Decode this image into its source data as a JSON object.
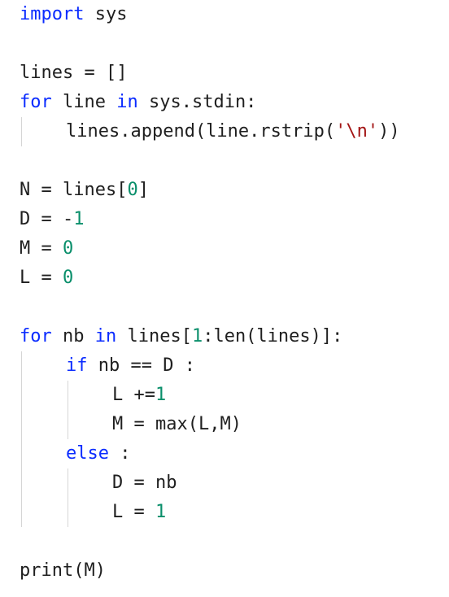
{
  "editor": {
    "language": "python",
    "colors": {
      "background": "#ffffff",
      "text": "#1f1f1f",
      "keyword": "#0b2cff",
      "number": "#0a8f6b",
      "string": "#a31515",
      "indent_guide": "#d6d6d6"
    },
    "lines": [
      {
        "indent": 0,
        "tokens": [
          {
            "t": "import",
            "k": "keyword"
          },
          {
            "t": " sys",
            "k": "plain"
          }
        ]
      },
      {
        "indent": 0,
        "tokens": []
      },
      {
        "indent": 0,
        "tokens": [
          {
            "t": "lines = []",
            "k": "plain"
          }
        ]
      },
      {
        "indent": 0,
        "tokens": [
          {
            "t": "for",
            "k": "keyword"
          },
          {
            "t": " line ",
            "k": "plain"
          },
          {
            "t": "in",
            "k": "keyword"
          },
          {
            "t": " sys.stdin:",
            "k": "plain"
          }
        ]
      },
      {
        "indent": 1,
        "tokens": [
          {
            "t": "lines.append(line.rstrip(",
            "k": "plain"
          },
          {
            "t": "'\\n'",
            "k": "string"
          },
          {
            "t": "))",
            "k": "plain"
          }
        ]
      },
      {
        "indent": 0,
        "tokens": []
      },
      {
        "indent": 0,
        "tokens": [
          {
            "t": "N = lines[",
            "k": "plain"
          },
          {
            "t": "0",
            "k": "number"
          },
          {
            "t": "]",
            "k": "plain"
          }
        ]
      },
      {
        "indent": 0,
        "tokens": [
          {
            "t": "D = -",
            "k": "plain"
          },
          {
            "t": "1",
            "k": "number"
          }
        ]
      },
      {
        "indent": 0,
        "tokens": [
          {
            "t": "M = ",
            "k": "plain"
          },
          {
            "t": "0",
            "k": "number"
          }
        ]
      },
      {
        "indent": 0,
        "tokens": [
          {
            "t": "L = ",
            "k": "plain"
          },
          {
            "t": "0",
            "k": "number"
          }
        ]
      },
      {
        "indent": 0,
        "tokens": []
      },
      {
        "indent": 0,
        "tokens": [
          {
            "t": "for",
            "k": "keyword"
          },
          {
            "t": " nb ",
            "k": "plain"
          },
          {
            "t": "in",
            "k": "keyword"
          },
          {
            "t": " lines[",
            "k": "plain"
          },
          {
            "t": "1",
            "k": "number"
          },
          {
            "t": ":len(lines)]:",
            "k": "plain"
          }
        ]
      },
      {
        "indent": 1,
        "tokens": [
          {
            "t": "if",
            "k": "keyword"
          },
          {
            "t": " nb == D :",
            "k": "plain"
          }
        ]
      },
      {
        "indent": 2,
        "tokens": [
          {
            "t": "L +=",
            "k": "plain"
          },
          {
            "t": "1",
            "k": "number"
          }
        ]
      },
      {
        "indent": 2,
        "tokens": [
          {
            "t": "M = max(L,M)",
            "k": "plain"
          }
        ]
      },
      {
        "indent": 1,
        "tokens": [
          {
            "t": "else",
            "k": "keyword"
          },
          {
            "t": " :",
            "k": "plain"
          }
        ]
      },
      {
        "indent": 2,
        "tokens": [
          {
            "t": "D = nb",
            "k": "plain"
          }
        ]
      },
      {
        "indent": 2,
        "tokens": [
          {
            "t": "L = ",
            "k": "plain"
          },
          {
            "t": "1",
            "k": "number"
          }
        ]
      },
      {
        "indent": 0,
        "tokens": []
      },
      {
        "indent": 0,
        "tokens": [
          {
            "t": "print(M)",
            "k": "plain"
          }
        ]
      }
    ]
  }
}
